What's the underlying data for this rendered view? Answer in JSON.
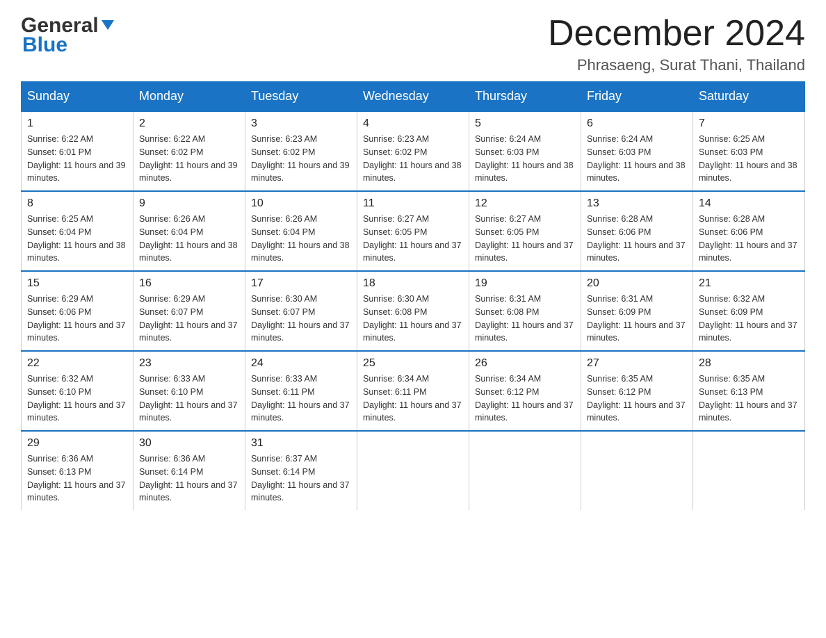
{
  "header": {
    "logo_general": "General",
    "logo_blue": "Blue",
    "main_title": "December 2024",
    "subtitle": "Phrasaeng, Surat Thani, Thailand"
  },
  "calendar": {
    "days": [
      "Sunday",
      "Monday",
      "Tuesday",
      "Wednesday",
      "Thursday",
      "Friday",
      "Saturday"
    ],
    "weeks": [
      [
        {
          "num": "1",
          "sunrise": "6:22 AM",
          "sunset": "6:01 PM",
          "daylight": "11 hours and 39 minutes."
        },
        {
          "num": "2",
          "sunrise": "6:22 AM",
          "sunset": "6:02 PM",
          "daylight": "11 hours and 39 minutes."
        },
        {
          "num": "3",
          "sunrise": "6:23 AM",
          "sunset": "6:02 PM",
          "daylight": "11 hours and 39 minutes."
        },
        {
          "num": "4",
          "sunrise": "6:23 AM",
          "sunset": "6:02 PM",
          "daylight": "11 hours and 38 minutes."
        },
        {
          "num": "5",
          "sunrise": "6:24 AM",
          "sunset": "6:03 PM",
          "daylight": "11 hours and 38 minutes."
        },
        {
          "num": "6",
          "sunrise": "6:24 AM",
          "sunset": "6:03 PM",
          "daylight": "11 hours and 38 minutes."
        },
        {
          "num": "7",
          "sunrise": "6:25 AM",
          "sunset": "6:03 PM",
          "daylight": "11 hours and 38 minutes."
        }
      ],
      [
        {
          "num": "8",
          "sunrise": "6:25 AM",
          "sunset": "6:04 PM",
          "daylight": "11 hours and 38 minutes."
        },
        {
          "num": "9",
          "sunrise": "6:26 AM",
          "sunset": "6:04 PM",
          "daylight": "11 hours and 38 minutes."
        },
        {
          "num": "10",
          "sunrise": "6:26 AM",
          "sunset": "6:04 PM",
          "daylight": "11 hours and 38 minutes."
        },
        {
          "num": "11",
          "sunrise": "6:27 AM",
          "sunset": "6:05 PM",
          "daylight": "11 hours and 37 minutes."
        },
        {
          "num": "12",
          "sunrise": "6:27 AM",
          "sunset": "6:05 PM",
          "daylight": "11 hours and 37 minutes."
        },
        {
          "num": "13",
          "sunrise": "6:28 AM",
          "sunset": "6:06 PM",
          "daylight": "11 hours and 37 minutes."
        },
        {
          "num": "14",
          "sunrise": "6:28 AM",
          "sunset": "6:06 PM",
          "daylight": "11 hours and 37 minutes."
        }
      ],
      [
        {
          "num": "15",
          "sunrise": "6:29 AM",
          "sunset": "6:06 PM",
          "daylight": "11 hours and 37 minutes."
        },
        {
          "num": "16",
          "sunrise": "6:29 AM",
          "sunset": "6:07 PM",
          "daylight": "11 hours and 37 minutes."
        },
        {
          "num": "17",
          "sunrise": "6:30 AM",
          "sunset": "6:07 PM",
          "daylight": "11 hours and 37 minutes."
        },
        {
          "num": "18",
          "sunrise": "6:30 AM",
          "sunset": "6:08 PM",
          "daylight": "11 hours and 37 minutes."
        },
        {
          "num": "19",
          "sunrise": "6:31 AM",
          "sunset": "6:08 PM",
          "daylight": "11 hours and 37 minutes."
        },
        {
          "num": "20",
          "sunrise": "6:31 AM",
          "sunset": "6:09 PM",
          "daylight": "11 hours and 37 minutes."
        },
        {
          "num": "21",
          "sunrise": "6:32 AM",
          "sunset": "6:09 PM",
          "daylight": "11 hours and 37 minutes."
        }
      ],
      [
        {
          "num": "22",
          "sunrise": "6:32 AM",
          "sunset": "6:10 PM",
          "daylight": "11 hours and 37 minutes."
        },
        {
          "num": "23",
          "sunrise": "6:33 AM",
          "sunset": "6:10 PM",
          "daylight": "11 hours and 37 minutes."
        },
        {
          "num": "24",
          "sunrise": "6:33 AM",
          "sunset": "6:11 PM",
          "daylight": "11 hours and 37 minutes."
        },
        {
          "num": "25",
          "sunrise": "6:34 AM",
          "sunset": "6:11 PM",
          "daylight": "11 hours and 37 minutes."
        },
        {
          "num": "26",
          "sunrise": "6:34 AM",
          "sunset": "6:12 PM",
          "daylight": "11 hours and 37 minutes."
        },
        {
          "num": "27",
          "sunrise": "6:35 AM",
          "sunset": "6:12 PM",
          "daylight": "11 hours and 37 minutes."
        },
        {
          "num": "28",
          "sunrise": "6:35 AM",
          "sunset": "6:13 PM",
          "daylight": "11 hours and 37 minutes."
        }
      ],
      [
        {
          "num": "29",
          "sunrise": "6:36 AM",
          "sunset": "6:13 PM",
          "daylight": "11 hours and 37 minutes."
        },
        {
          "num": "30",
          "sunrise": "6:36 AM",
          "sunset": "6:14 PM",
          "daylight": "11 hours and 37 minutes."
        },
        {
          "num": "31",
          "sunrise": "6:37 AM",
          "sunset": "6:14 PM",
          "daylight": "11 hours and 37 minutes."
        },
        null,
        null,
        null,
        null
      ]
    ]
  }
}
